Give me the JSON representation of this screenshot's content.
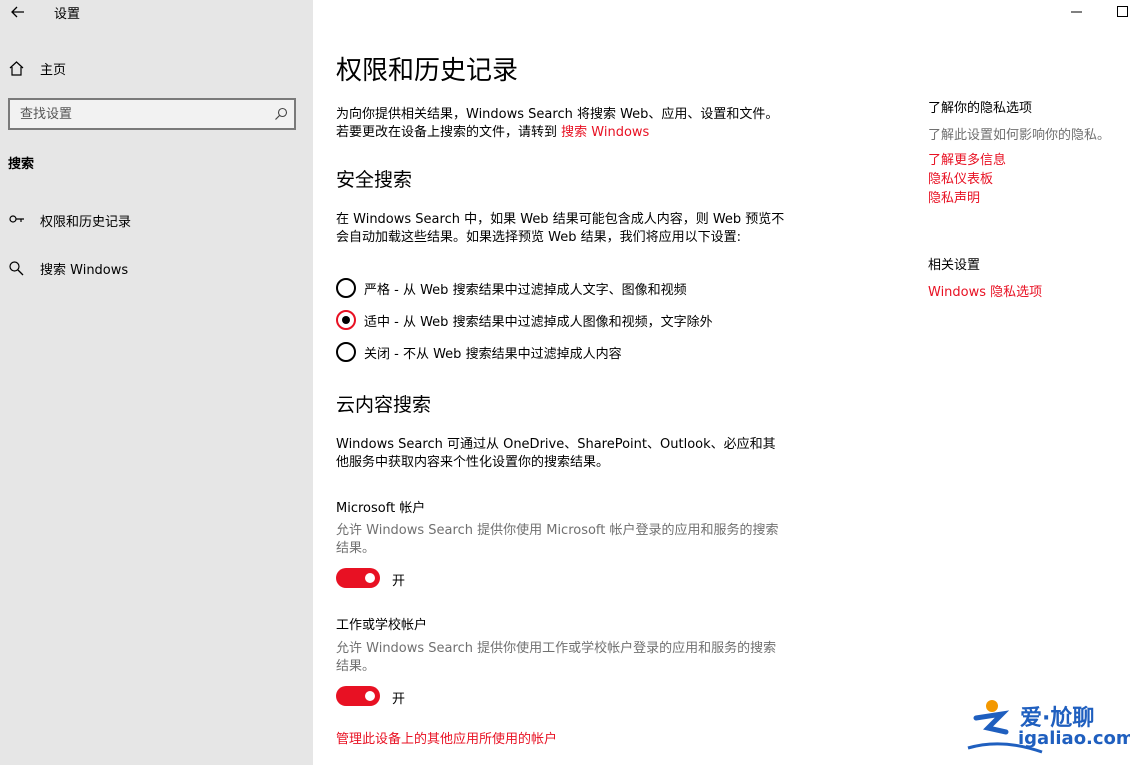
{
  "app": {
    "title": "设置"
  },
  "sidebar": {
    "home_label": "主页",
    "search_placeholder": "查找设置",
    "section": "搜索",
    "items": [
      {
        "label": "权限和历史记录",
        "icon": "permissions-icon"
      },
      {
        "label": "搜索 Windows",
        "icon": "search-icon"
      }
    ]
  },
  "main": {
    "title": "权限和历史记录",
    "intro_text": "为向你提供相关结果，Windows Search 将搜索 Web、应用、设置和文件。若要更改在设备上搜索的文件，请转到 ",
    "intro_link": "搜索 Windows",
    "safe_search": {
      "heading": "安全搜索",
      "description": "在 Windows Search 中，如果 Web 结果可能包含成人内容，则 Web 预览不会自动加载这些结果。如果选择预览 Web 结果，我们将应用以下设置:",
      "options": [
        {
          "label": "严格 - 从 Web 搜索结果中过滤掉成人文字、图像和视频",
          "checked": false
        },
        {
          "label": "适中 - 从 Web 搜索结果中过滤掉成人图像和视频，文字除外",
          "checked": true
        },
        {
          "label": "关闭 - 不从 Web 搜索结果中过滤掉成人内容",
          "checked": false
        }
      ]
    },
    "cloud_search": {
      "heading": "云内容搜索",
      "description": "Windows Search 可通过从 OneDrive、SharePoint、Outlook、必应和其他服务中获取内容来个性化设置你的搜索结果。",
      "microsoft_account": {
        "title": "Microsoft 帐户",
        "description": "允许 Windows Search 提供你使用 Microsoft 帐户登录的应用和服务的搜索结果。",
        "state": "开",
        "on": true
      },
      "work_account": {
        "title": "工作或学校帐户",
        "description": "允许 Windows Search 提供你使用工作或学校帐户登录的应用和服务的搜索结果。",
        "state": "开",
        "on": true
      },
      "manage_link": "管理此设备上的其他应用所使用的帐户"
    }
  },
  "right_column": {
    "privacy_heading": "了解你的隐私选项",
    "privacy_text": "了解此设置如何影响你的隐私。",
    "links": [
      "了解更多信息",
      "隐私仪表板",
      "隐私声明"
    ],
    "related_heading": "相关设置",
    "related_link": "Windows 隐私选项"
  },
  "watermark": {
    "chinese": "爱·尬聊",
    "domain": "igaliao.com"
  },
  "colors": {
    "accent": "#e81123",
    "sidebar_bg": "#e6e6e6",
    "text_gray": "#707070",
    "watermark_blue": "#1f5fbf",
    "watermark_orange": "#f39800"
  }
}
